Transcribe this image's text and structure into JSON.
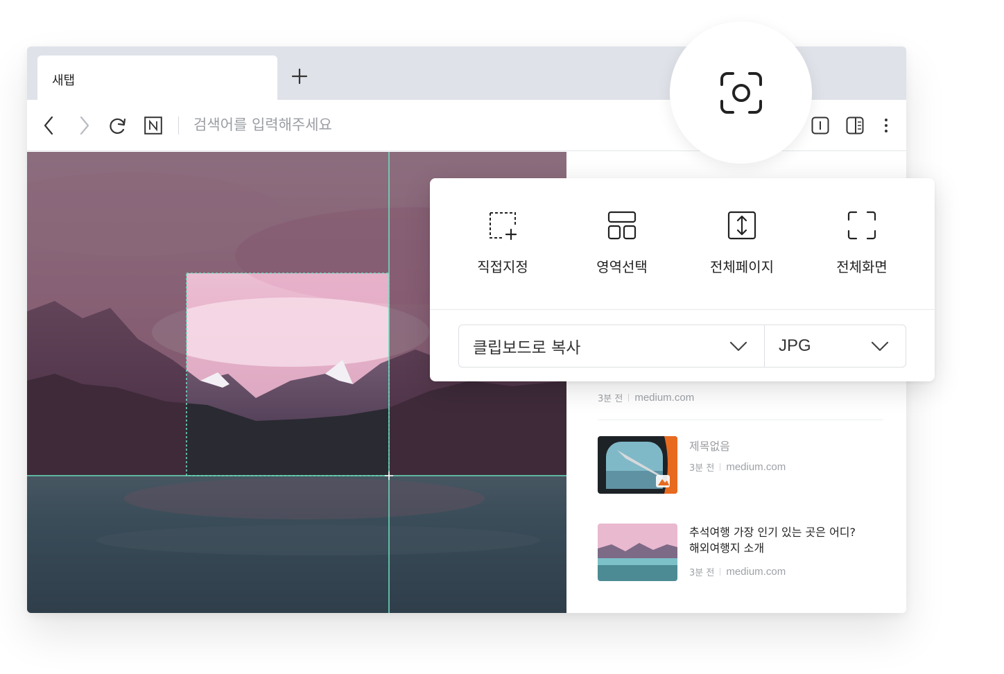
{
  "tab": {
    "title": "새탭",
    "new_tab_icon": "plus-icon"
  },
  "toolbar": {
    "back_icon": "chevron-left-icon",
    "forward_icon": "chevron-right-icon",
    "reload_icon": "reload-icon",
    "home_logo": "N",
    "url_placeholder": "검색어를 입력해주세요",
    "reader_icon": "reader-mode-icon",
    "sidepanel_icon": "side-panel-icon",
    "menu_icon": "more-vertical-icon"
  },
  "capture_button": {
    "icon": "camera-capture-icon"
  },
  "capture_panel": {
    "modes": [
      {
        "label": "직접지정",
        "icon": "custom-area-icon"
      },
      {
        "label": "영역선택",
        "icon": "area-select-icon"
      },
      {
        "label": "전체페이지",
        "icon": "full-page-icon"
      },
      {
        "label": "전체화면",
        "icon": "full-screen-icon"
      }
    ],
    "output_select": {
      "value": "클립보드로 복사"
    },
    "format_select": {
      "value": "JPG"
    }
  },
  "sidebar": {
    "top_item": {
      "time": "3분 전",
      "domain": "medium.com"
    },
    "news": [
      {
        "title": "제목없음",
        "time": "3분 전",
        "domain": "medium.com"
      },
      {
        "title_line1": "추석여행 가장 인기 있는 곳은 어디?",
        "title_line2": "해외여행지 소개",
        "time": "3분 전",
        "domain": "medium.com"
      }
    ]
  },
  "colors": {
    "guide_line": "#6fe3c1",
    "tabbar_bg": "#dfe2e8",
    "overlay": "#5a3048"
  }
}
